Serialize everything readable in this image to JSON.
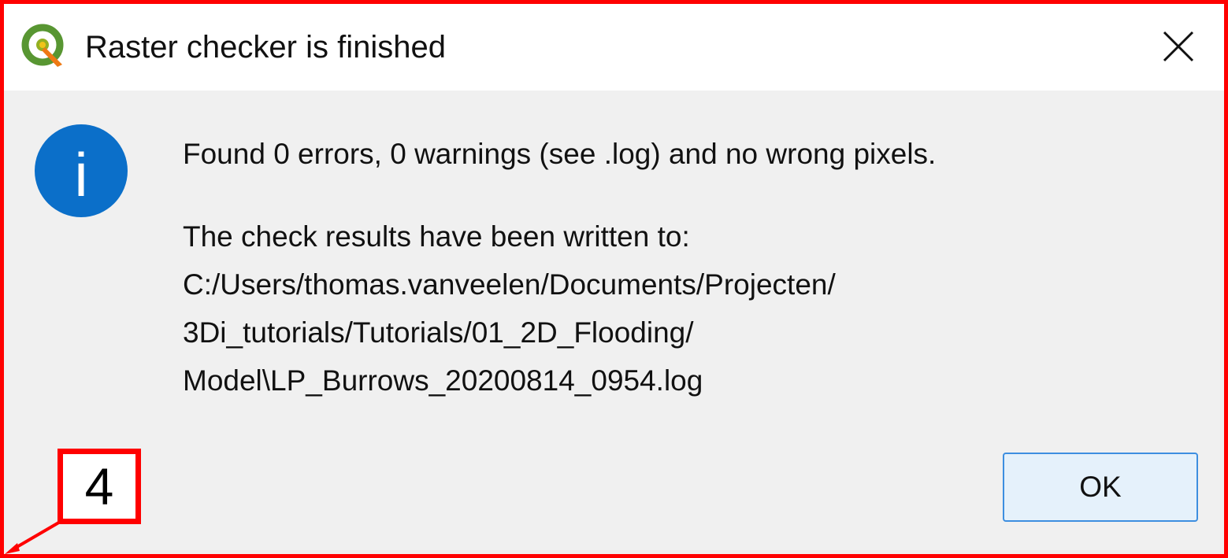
{
  "dialog": {
    "title": "Raster checker is finished",
    "app_icon": "qgis-logo-icon",
    "close_icon": "close-icon",
    "info_icon": "information-icon",
    "info_icon_letter": "i",
    "message_lines": [
      "Found 0 errors, 0 warnings (see .log) and no wrong pixels.",
      "",
      " The check results have been written to:",
      " C:/Users/thomas.vanveelen/Documents/Projecten/",
      "3Di_tutorials/Tutorials/01_2D_Flooding/",
      "Model\\LP_Burrows_20200814_0954.log"
    ],
    "ok_label": "OK"
  },
  "annotation": {
    "label": "4",
    "color": "#ff0000"
  },
  "colors": {
    "info_blue": "#0b6fc9",
    "button_border": "#3d8ee0",
    "button_fill": "#e5f1fb",
    "dialog_body": "#f0f0f0",
    "annotation_red": "#ff0000"
  }
}
